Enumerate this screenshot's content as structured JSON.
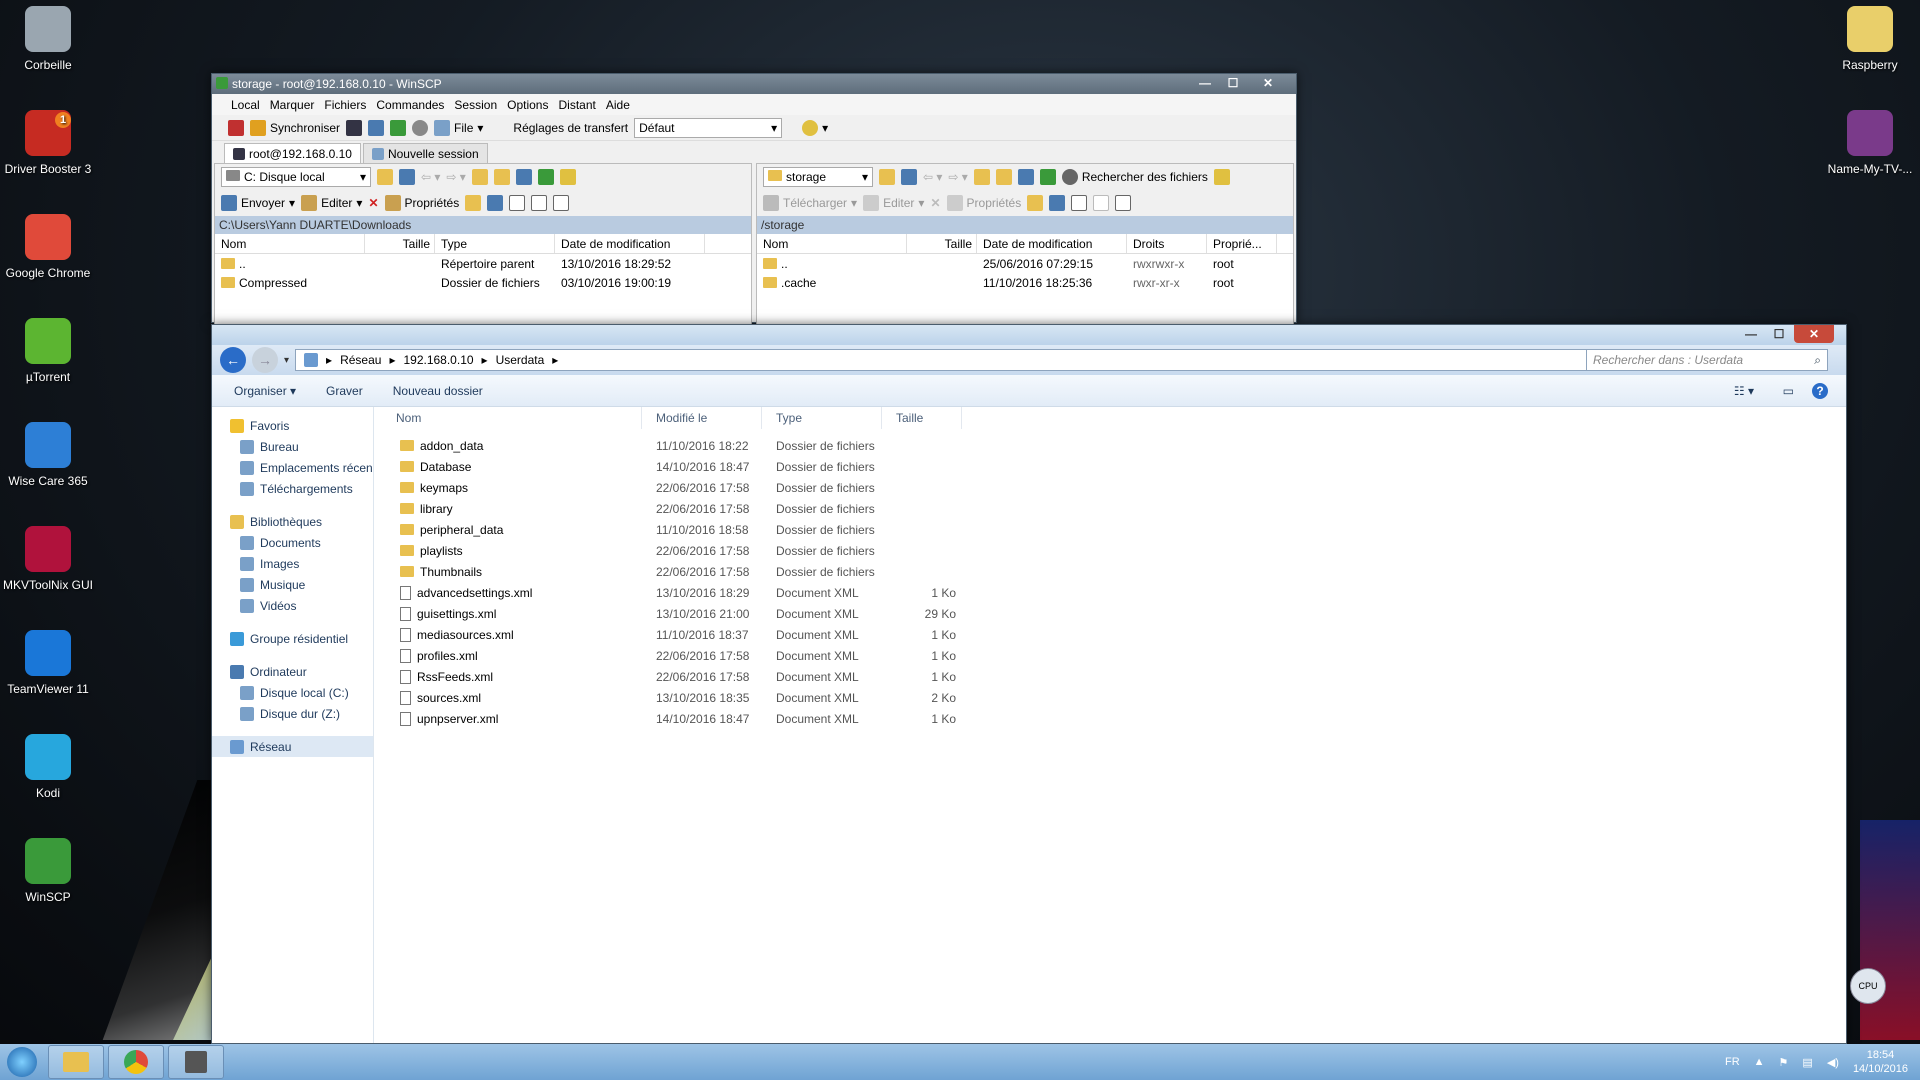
{
  "desktop": {
    "left_icons": [
      {
        "label": "Corbeille",
        "icon": "recycle-bin-icon",
        "color": "#9aa6b0"
      },
      {
        "label": "Driver Booster 3",
        "icon": "driver-booster-icon",
        "color": "#c62b22",
        "badge": "1"
      },
      {
        "label": "Google Chrome",
        "icon": "chrome-icon",
        "color": "#e04a3a"
      },
      {
        "label": "µTorrent",
        "icon": "utorrent-icon",
        "color": "#5cb531"
      },
      {
        "label": "Wise Care 365",
        "icon": "wise-care-icon",
        "color": "#2d7fd6"
      },
      {
        "label": "MKVToolNix GUI",
        "icon": "mkvtoolnix-icon",
        "color": "#b0123c"
      },
      {
        "label": "TeamViewer 11",
        "icon": "teamviewer-icon",
        "color": "#1a77d8"
      },
      {
        "label": "Kodi",
        "icon": "kodi-icon",
        "color": "#27a7dd"
      },
      {
        "label": "WinSCP",
        "icon": "winscp-icon",
        "color": "#3a9a3a"
      }
    ],
    "right_icons": [
      {
        "label": "Raspberry",
        "icon": "folder-icon",
        "color": "#e9cf6a"
      },
      {
        "label": "Name-My-TV-...",
        "icon": "archive-icon",
        "color": "#7a3a8a"
      }
    ]
  },
  "winscp": {
    "title": "storage - root@192.168.0.10 - WinSCP",
    "menu": [
      "Local",
      "Marquer",
      "Fichiers",
      "Commandes",
      "Session",
      "Options",
      "Distant",
      "Aide"
    ],
    "toolbar": {
      "sync_label": "Synchroniser",
      "file_label": "File",
      "transfer_label": "Réglages de transfert",
      "transfer_value": "Défaut"
    },
    "tabs": [
      {
        "label": "root@192.168.0.10"
      },
      {
        "label": "Nouvelle session"
      }
    ],
    "left": {
      "drive": "C: Disque local",
      "send_label": "Envoyer",
      "edit_label": "Editer",
      "props_label": "Propriétés",
      "path": "C:\\Users\\Yann DUARTE\\Downloads",
      "columns": [
        "Nom",
        "Taille",
        "Type",
        "Date de modification"
      ],
      "rows": [
        {
          "name": "..",
          "size": "",
          "type": "Répertoire parent",
          "date": "13/10/2016  18:29:52"
        },
        {
          "name": "Compressed",
          "size": "",
          "type": "Dossier de fichiers",
          "date": "03/10/2016  19:00:19"
        }
      ]
    },
    "right": {
      "drive": "storage",
      "search_label": "Rechercher des fichiers",
      "download_label": "Télécharger",
      "edit_label": "Editer",
      "props_label": "Propriétés",
      "path": "/storage",
      "columns": [
        "Nom",
        "Taille",
        "Date de modification",
        "Droits",
        "Proprié..."
      ],
      "rows": [
        {
          "name": "..",
          "size": "",
          "date": "25/06/2016 07:29:15",
          "rights": "rwxrwxr-x",
          "owner": "root"
        },
        {
          "name": ".cache",
          "size": "",
          "date": "11/10/2016 18:25:36",
          "rights": "rwxr-xr-x",
          "owner": "root"
        }
      ]
    }
  },
  "explorer": {
    "breadcrumb": [
      "Réseau",
      "192.168.0.10",
      "Userdata"
    ],
    "search_placeholder": "Rechercher dans : Userdata",
    "commands": {
      "organize": "Organiser",
      "burn": "Graver",
      "new_folder": "Nouveau dossier"
    },
    "nav": {
      "favorites": "Favoris",
      "fav_items": [
        "Bureau",
        "Emplacements récen",
        "Téléchargements"
      ],
      "libraries": "Bibliothèques",
      "lib_items": [
        "Documents",
        "Images",
        "Musique",
        "Vidéos"
      ],
      "homegroup": "Groupe résidentiel",
      "computer": "Ordinateur",
      "comp_items": [
        "Disque local (C:)",
        "Disque dur (Z:)"
      ],
      "network": "Réseau"
    },
    "columns": [
      "Nom",
      "Modifié le",
      "Type",
      "Taille"
    ],
    "files": [
      {
        "name": "addon_data",
        "date": "11/10/2016 18:22",
        "type": "Dossier de fichiers",
        "size": ""
      },
      {
        "name": "Database",
        "date": "14/10/2016 18:47",
        "type": "Dossier de fichiers",
        "size": ""
      },
      {
        "name": "keymaps",
        "date": "22/06/2016 17:58",
        "type": "Dossier de fichiers",
        "size": ""
      },
      {
        "name": "library",
        "date": "22/06/2016 17:58",
        "type": "Dossier de fichiers",
        "size": ""
      },
      {
        "name": "peripheral_data",
        "date": "11/10/2016 18:58",
        "type": "Dossier de fichiers",
        "size": ""
      },
      {
        "name": "playlists",
        "date": "22/06/2016 17:58",
        "type": "Dossier de fichiers",
        "size": ""
      },
      {
        "name": "Thumbnails",
        "date": "22/06/2016 17:58",
        "type": "Dossier de fichiers",
        "size": ""
      },
      {
        "name": "advancedsettings.xml",
        "date": "13/10/2016 18:29",
        "type": "Document XML",
        "size": "1 Ko"
      },
      {
        "name": "guisettings.xml",
        "date": "13/10/2016 21:00",
        "type": "Document XML",
        "size": "29 Ko"
      },
      {
        "name": "mediasources.xml",
        "date": "11/10/2016 18:37",
        "type": "Document XML",
        "size": "1 Ko"
      },
      {
        "name": "profiles.xml",
        "date": "22/06/2016 17:58",
        "type": "Document XML",
        "size": "1 Ko"
      },
      {
        "name": "RssFeeds.xml",
        "date": "22/06/2016 17:58",
        "type": "Document XML",
        "size": "1 Ko"
      },
      {
        "name": "sources.xml",
        "date": "13/10/2016 18:35",
        "type": "Document XML",
        "size": "2 Ko"
      },
      {
        "name": "upnpserver.xml",
        "date": "14/10/2016 18:47",
        "type": "Document XML",
        "size": "1 Ko"
      }
    ]
  },
  "taskbar": {
    "lang": "FR",
    "time": "18:54",
    "date": "14/10/2016",
    "cpu_label": "CPU"
  }
}
